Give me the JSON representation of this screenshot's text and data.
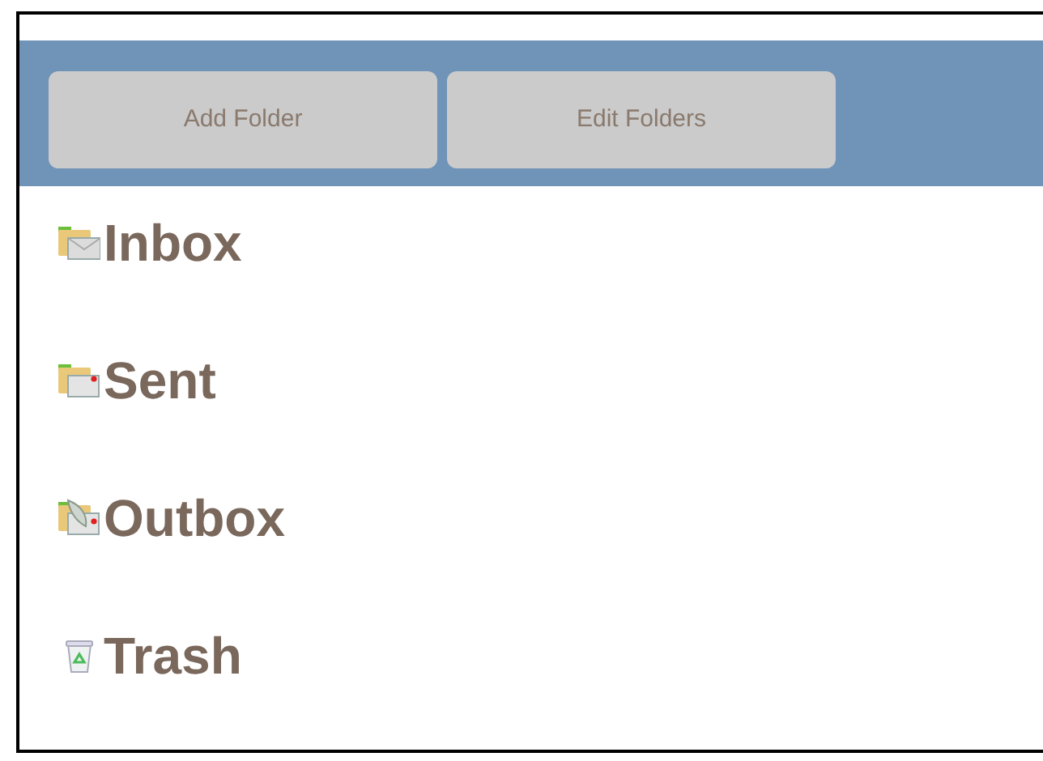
{
  "toolbar": {
    "buttons": [
      "Add Folder",
      "Edit Folders"
    ]
  },
  "folders": [
    {
      "label": "Inbox",
      "kind": "inbox"
    },
    {
      "label": "Sent",
      "kind": "sent"
    },
    {
      "label": "Outbox",
      "kind": "outbox"
    },
    {
      "label": "Trash",
      "kind": "trash"
    }
  ]
}
